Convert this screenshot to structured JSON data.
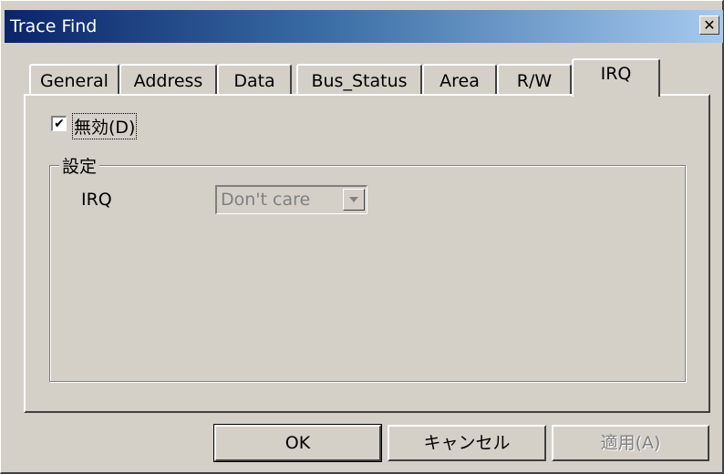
{
  "window": {
    "title": "Trace Find",
    "close_glyph": "✕"
  },
  "tabs": [
    {
      "label": "General"
    },
    {
      "label": "Address"
    },
    {
      "label": "Data"
    },
    {
      "label": "Bus_Status"
    },
    {
      "label": "Area"
    },
    {
      "label": "R/W"
    },
    {
      "label": "IRQ",
      "active": true
    }
  ],
  "panel": {
    "disable_checkbox": {
      "label": "無効(D)",
      "checked": true,
      "check_glyph": "✔"
    },
    "settings_group": {
      "legend": "設定",
      "irq_label": "IRQ",
      "irq_select": {
        "value": "Don't care",
        "disabled": true
      }
    }
  },
  "buttons": {
    "ok": "OK",
    "cancel": "キャンセル",
    "apply": "適用(A)"
  },
  "colors": {
    "face": "#d4d0c8",
    "title_gradient_start": "#0a246a",
    "title_gradient_end": "#a6caf0",
    "disabled_text": "#808080"
  }
}
